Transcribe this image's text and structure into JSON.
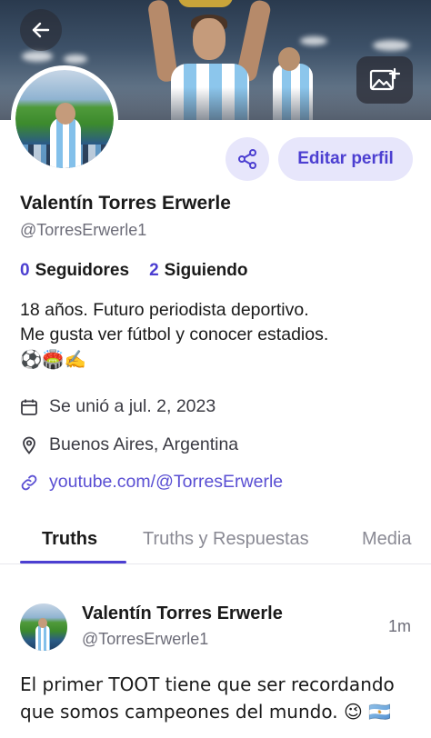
{
  "header": {
    "back_icon": "arrow-left-icon",
    "cover_icon": "image-plus-icon"
  },
  "profile": {
    "name": "Valentín Torres Erwerle",
    "handle": "@TorresErwerle1",
    "share_icon": "share-icon",
    "edit_button_label": "Editar perfil",
    "followers_count": "0",
    "followers_label": "Seguidores",
    "following_count": "2",
    "following_label": "Siguiendo",
    "bio_line1": "18 años. Futuro periodista deportivo.",
    "bio_line2": "Me gusta ver fútbol y conocer estadios.",
    "bio_emojis": "⚽🏟️✍️",
    "joined_icon": "calendar-icon",
    "joined_text": "Se unió a jul. 2, 2023",
    "location_icon": "map-pin-icon",
    "location_text": "Buenos Aires, Argentina",
    "website_icon": "link-icon",
    "website_text": "youtube.com/@TorresErwerle"
  },
  "tabs": [
    {
      "label": "Truths",
      "active": true
    },
    {
      "label": "Truths y Respuestas",
      "active": false
    },
    {
      "label": "Media",
      "active": false
    }
  ],
  "post": {
    "author_name": "Valentín Torres Erwerle",
    "author_handle": "@TorresErwerle1",
    "time": "1m",
    "text": "El primer TOOT tiene que ser recordando que somos campeones del mundo. 😉 🇦🇷"
  },
  "colors": {
    "accent": "#4c3fd1",
    "accent_soft": "#e7e6fb",
    "link": "#5a4fd3",
    "muted_text": "#6c6c78"
  }
}
